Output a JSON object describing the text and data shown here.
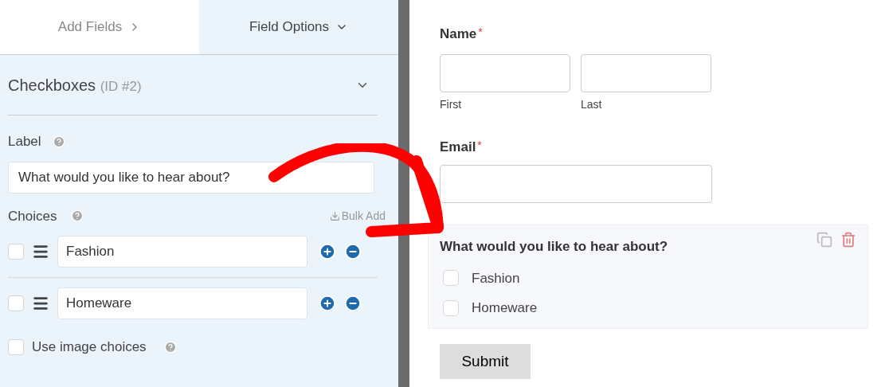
{
  "tabs": [
    {
      "label": "Add Fields",
      "expanded": false,
      "selected": false
    },
    {
      "label": "Field Options",
      "expanded": true,
      "selected": true
    }
  ],
  "field_options": {
    "title": "Checkboxes",
    "id": "(ID #2)",
    "expanded": true,
    "label": {
      "text": "Label",
      "value": "What would you like to hear about?"
    },
    "choices": {
      "text": "Choices",
      "bulk_add": "Bulk Add",
      "items": [
        {
          "value": "Fashion",
          "checked": false
        },
        {
          "value": "Homeware",
          "checked": false
        }
      ]
    },
    "image_choices": {
      "text": "Use image choices",
      "checked": false
    }
  },
  "form": {
    "name": {
      "label": "Name",
      "required_mark": "*",
      "sublabels": [
        "First",
        "Last"
      ]
    },
    "email": {
      "label": "Email",
      "required_mark": "*"
    },
    "question": {
      "label": "What would you like to hear about?",
      "options": [
        {
          "label": "Fashion",
          "checked": false
        },
        {
          "label": "Homeware",
          "checked": false
        }
      ]
    },
    "submit": "Submit"
  }
}
